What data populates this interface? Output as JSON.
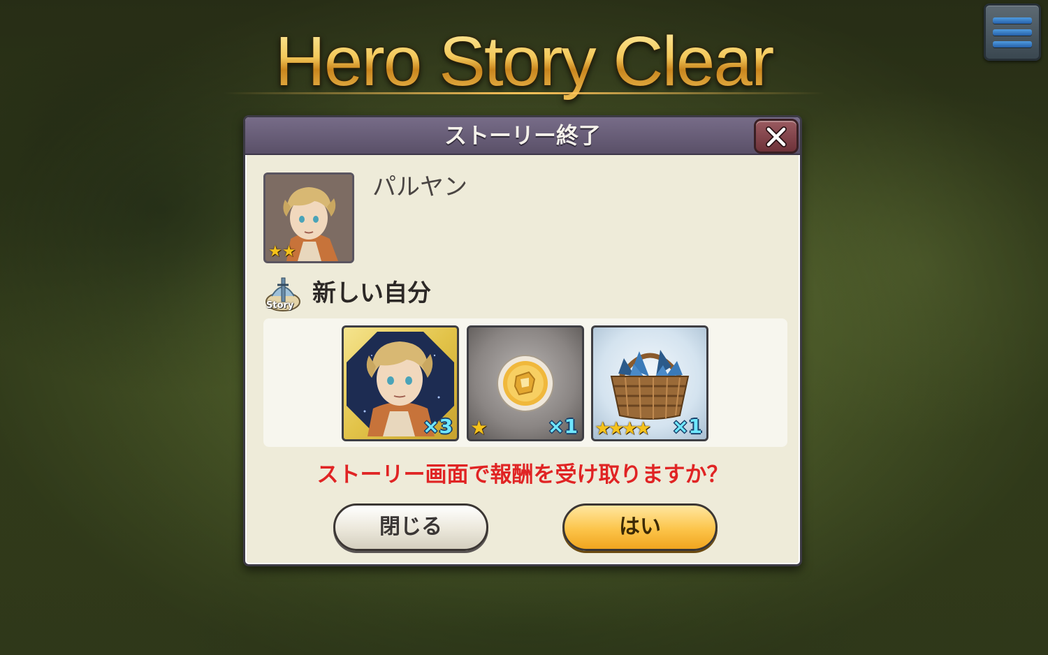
{
  "banner": {
    "title": "Hero Story Clear"
  },
  "menu": {
    "icon": "hamburger-menu-icon"
  },
  "dialog": {
    "title": "ストーリー終了",
    "close_icon": "close-x-icon",
    "hero": {
      "name": "パルヤン",
      "stars": "★★",
      "rarity_stars": 2
    },
    "story": {
      "icon": "story-quill-icon",
      "icon_label": "Story",
      "title": "新しい自分"
    },
    "rewards": [
      {
        "name": "hero-shard",
        "icon": "hero-portrait-icon",
        "quantity": "×3",
        "stars": ""
      },
      {
        "name": "gold-coin",
        "icon": "gold-coin-icon",
        "quantity": "×1",
        "stars": "★"
      },
      {
        "name": "herb-basket",
        "icon": "herb-basket-icon",
        "quantity": "×1",
        "stars": "★★★★"
      }
    ],
    "prompt": "ストーリー画面で報酬を受け取りますか？",
    "buttons": {
      "close": "閉じる",
      "yes": "はい"
    }
  },
  "colors": {
    "dialog_bg": "#eeebd9",
    "header_bg": "#6b6079",
    "prompt_text": "#e02424",
    "yes_button": "#fcc44a",
    "quantity_text": "#6fe7ff",
    "banner_gold": "#f1c55a"
  }
}
